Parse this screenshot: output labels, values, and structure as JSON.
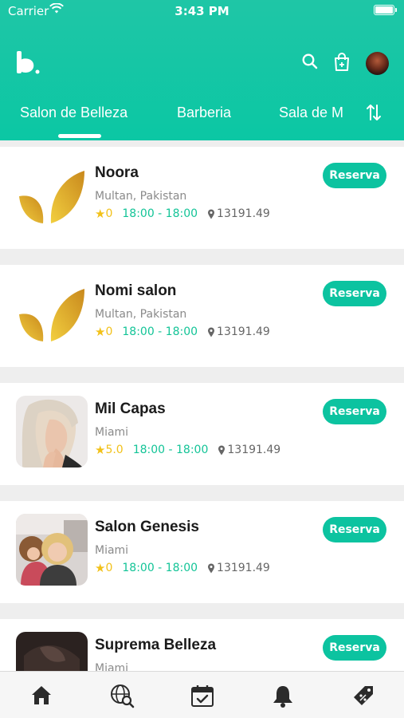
{
  "status_bar": {
    "carrier": "Carrier",
    "time": "3:43 PM"
  },
  "header": {
    "tabs": [
      {
        "label": "Salon de Belleza",
        "active": true
      },
      {
        "label": "Barberia",
        "active": false
      },
      {
        "label": "Sala de M",
        "active": false
      }
    ]
  },
  "salons": [
    {
      "name": "Noora",
      "location": "Multan, Pakistan",
      "rating": "0",
      "hours": "18:00 - 18:00",
      "distance": "13191.49",
      "action": "Reserva",
      "image": "leaf-logo"
    },
    {
      "name": "Nomi salon",
      "location": "Multan, Pakistan",
      "rating": "0",
      "hours": "18:00 - 18:00",
      "distance": "13191.49",
      "action": "Reserva",
      "image": "leaf-logo"
    },
    {
      "name": "Mil Capas",
      "location": "Miami",
      "rating": "5.0",
      "hours": "18:00 - 18:00",
      "distance": "13191.49",
      "action": "Reserva",
      "image": "woman-portrait"
    },
    {
      "name": "Salon Genesis",
      "location": "Miami",
      "rating": "0",
      "hours": "18:00 - 18:00",
      "distance": "13191.49",
      "action": "Reserva",
      "image": "salon-photo"
    },
    {
      "name": "Suprema Belleza",
      "location": "Miami",
      "action": "Reserva",
      "image": "dark-photo"
    }
  ],
  "bottom_nav": [
    "home-icon",
    "globe-search-icon",
    "calendar-check-icon",
    "bell-icon",
    "offer-tag-icon"
  ],
  "colors": {
    "accent": "#0cc3a0",
    "rating": "#f2c119",
    "hours": "#13c497"
  }
}
